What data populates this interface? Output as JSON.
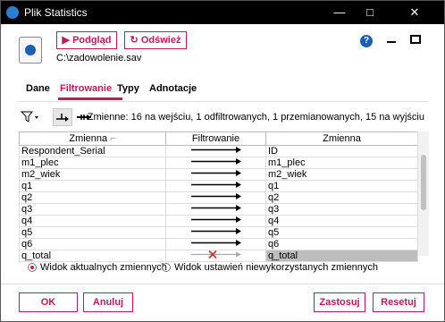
{
  "window": {
    "title": "Plik Statistics",
    "controls": {
      "minimize": "—",
      "maximize": "□",
      "close": "✕"
    }
  },
  "toolbar": {
    "preview_label": "Podgląd",
    "refresh_label": "Odśwież",
    "icons": [
      "help-icon",
      "minimize-icon",
      "maximize-icon"
    ]
  },
  "file": {
    "path": "C:\\zadowolenie.sav"
  },
  "tabs": [
    {
      "label": "Dane"
    },
    {
      "label": "Filtrowanie"
    },
    {
      "label": "Typy"
    },
    {
      "label": "Adnotacje"
    }
  ],
  "filter_toolbar": {
    "summary": "Zmienne: 16 na wejściu, 1 odfiltrowanych, 1 przemianowanych, 15 na wyjściu"
  },
  "table": {
    "headers": [
      "Zmienna",
      "Filtrowanie",
      "Zmienna"
    ],
    "rows": [
      {
        "in": "Respondent_Serial",
        "state": "pass",
        "out": "ID"
      },
      {
        "in": "m1_plec",
        "state": "pass",
        "out": "m1_plec"
      },
      {
        "in": "m2_wiek",
        "state": "pass",
        "out": "m2_wiek"
      },
      {
        "in": "q1",
        "state": "pass",
        "out": "q1"
      },
      {
        "in": "q2",
        "state": "pass",
        "out": "q2"
      },
      {
        "in": "q3",
        "state": "pass",
        "out": "q3"
      },
      {
        "in": "q4",
        "state": "pass",
        "out": "q4"
      },
      {
        "in": "q5",
        "state": "pass",
        "out": "q5"
      },
      {
        "in": "q6",
        "state": "pass",
        "out": "q6"
      },
      {
        "in": "q_total",
        "state": "blocked",
        "out": "q_total"
      }
    ]
  },
  "view_options": {
    "selected": 0,
    "options": [
      "Widok aktualnych zmiennych",
      "Widok ustawień niewykorzystanych zmiennych"
    ]
  },
  "buttons": {
    "ok": "OK",
    "cancel": "Anuluj",
    "apply": "Zastosuj",
    "reset": "Resetuj"
  },
  "colors": {
    "accent": "#c2185b",
    "blocked": "#d32f2f",
    "titlebar": "#000000"
  }
}
